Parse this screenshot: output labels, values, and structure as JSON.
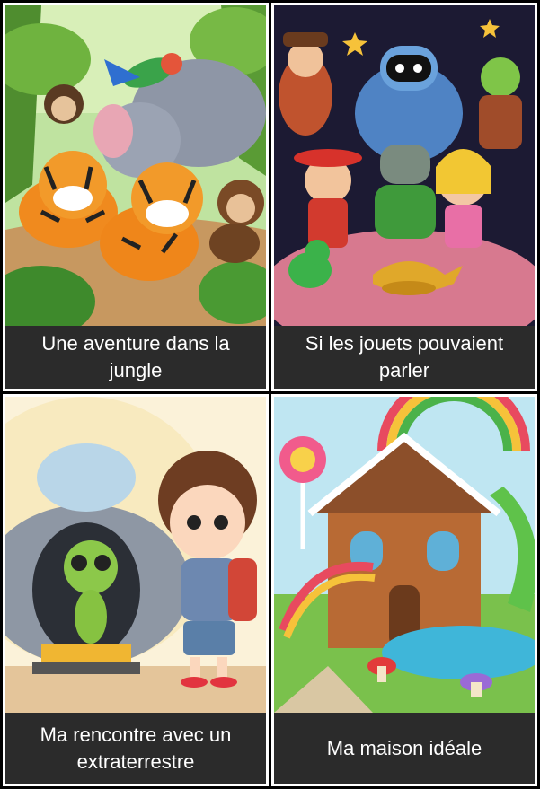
{
  "cards": [
    {
      "title": "Une aventure dans la jungle",
      "illustration": "jungle-animals-illustration"
    },
    {
      "title": "Si les jouets pouvaient parler",
      "illustration": "toys-illustration"
    },
    {
      "title": "Ma rencontre avec un extraterrestre",
      "illustration": "alien-encounter-illustration"
    },
    {
      "title": "Ma maison idéale",
      "illustration": "candy-house-illustration"
    }
  ],
  "colors": {
    "caption_bg": "#2b2b2b",
    "caption_text": "#ffffff",
    "sheet_bg": "#000000"
  }
}
